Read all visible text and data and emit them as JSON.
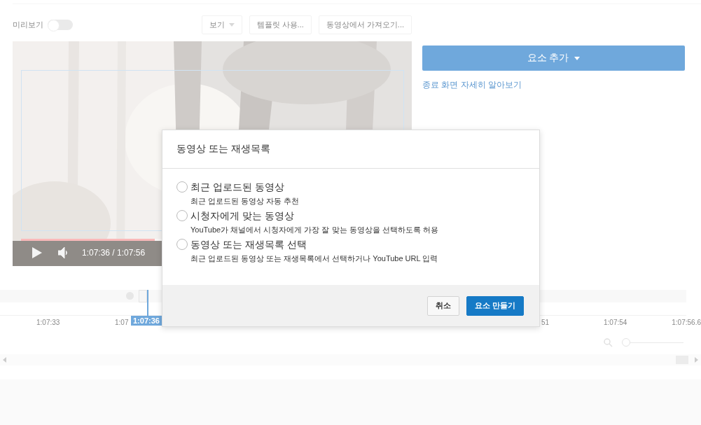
{
  "toolbar": {
    "preview": {
      "label": "미리보기",
      "on": false
    },
    "buttons": [
      {
        "label": "보기",
        "kind": "dropdown"
      },
      {
        "label": "템플릿 사용..."
      },
      {
        "label": "동영상에서 가져오기..."
      }
    ]
  },
  "player": {
    "time": "1:07:36 / 1:07:56",
    "level": 0.35
  },
  "side": {
    "add_button": "요소 추가",
    "learn_link": "종료 화면 자세히 알아보기"
  },
  "timeline": {
    "marker": "1:07:36",
    "zoom": {
      "level": 0
    },
    "ticks": [
      "1:07:33",
      "1:07",
      "51",
      "1:07:54",
      "1:07:56.6"
    ]
  },
  "dialog": {
    "title": "동영상 또는 재생목록",
    "options": [
      {
        "label": "최근 업로드된 동영상",
        "description": "최근 업로드된 동영상 자동 추천",
        "selected": false
      },
      {
        "label": "시청자에게 맞는 동영상",
        "description": "YouTube가 채널에서 시청자에게 가장 잘 맞는 동영상을 선택하도록 허용",
        "selected": false
      },
      {
        "label": "동영상 또는 재생목록 선택",
        "description": "최근 업로드된 동영상 또는 재생목록에서 선택하거나 YouTube URL 입력",
        "selected": false
      }
    ],
    "buttons": [
      {
        "label": "취소",
        "kind": "secondary"
      },
      {
        "label": "요소 만들기",
        "kind": "primary"
      }
    ]
  }
}
